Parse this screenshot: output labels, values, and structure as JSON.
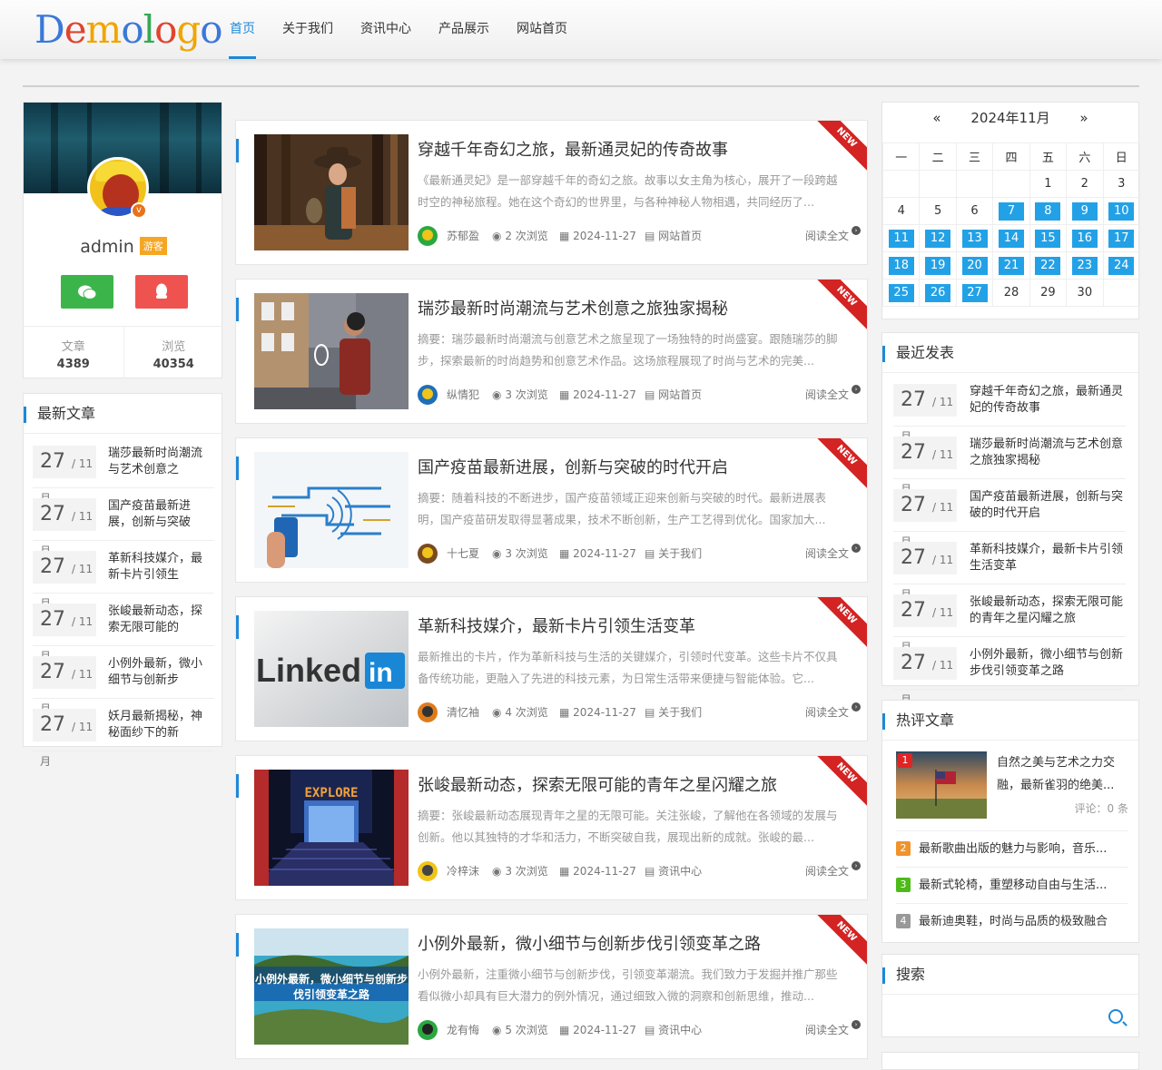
{
  "logo": {
    "letters": [
      "D",
      "e",
      "m",
      "o",
      "l",
      "o",
      "g",
      "o"
    ],
    "colors": [
      "#3b78d8",
      "#e0442f",
      "#f0a500",
      "#3b78d8",
      "#34a853",
      "#e0442f",
      "#f0a500",
      "#3b78d8"
    ]
  },
  "nav": [
    "首页",
    "关于我们",
    "资讯中心",
    "产品展示",
    "网站首页"
  ],
  "profile": {
    "name": "admin",
    "role": "游客",
    "posts_label": "文章",
    "posts": "4389",
    "views_label": "浏览",
    "views": "40354"
  },
  "latest": {
    "title": "最新文章",
    "items": [
      {
        "day": "27",
        "month": "/ 11月",
        "title": "瑞莎最新时尚潮流与艺术创意之"
      },
      {
        "day": "27",
        "month": "/ 11月",
        "title": "国产疫苗最新进展，创新与突破"
      },
      {
        "day": "27",
        "month": "/ 11月",
        "title": "革新科技媒介，最新卡片引领生"
      },
      {
        "day": "27",
        "month": "/ 11月",
        "title": "张峻最新动态，探索无限可能的"
      },
      {
        "day": "27",
        "month": "/ 11月",
        "title": "小例外最新，微小细节与创新步"
      },
      {
        "day": "27",
        "month": "/ 11月",
        "title": "妖月最新揭秘，神秘面纱下的新"
      }
    ]
  },
  "articles": [
    {
      "title": "穿越千年奇幻之旅，最新通灵妃的传奇故事",
      "excerpt": "《最新通灵妃》是一部穿越千年的奇幻之旅。故事以女主角为核心，展开了一段跨越时空的神秘旅程。她在这个奇幻的世界里，与各种神秘人物相遇，共同经历了...",
      "author": "苏郁盈",
      "views": "2 次浏览",
      "date": "2024-11-27",
      "cat": "网站首页",
      "read": "阅读全文",
      "ribbon": "NEW"
    },
    {
      "title": "瑞莎最新时尚潮流与艺术创意之旅独家揭秘",
      "excerpt": "摘要：瑞莎最新时尚潮流与创意艺术之旅呈现了一场独特的时尚盛宴。跟随瑞莎的脚步，探索最新的时尚趋势和创意艺术作品。这场旅程展现了时尚与艺术的完美...",
      "author": "纵情犯",
      "views": "3 次浏览",
      "date": "2024-11-27",
      "cat": "网站首页",
      "read": "阅读全文",
      "ribbon": "NEW"
    },
    {
      "title": "国产疫苗最新进展，创新与突破的时代开启",
      "excerpt": "摘要：随着科技的不断进步，国产疫苗领域正迎来创新与突破的时代。最新进展表明，国产疫苗研发取得显著成果，技术不断创新，生产工艺得到优化。国家加大...",
      "author": "十七夏",
      "views": "3 次浏览",
      "date": "2024-11-27",
      "cat": "关于我们",
      "read": "阅读全文",
      "ribbon": "NEW"
    },
    {
      "title": "革新科技媒介，最新卡片引领生活变革",
      "excerpt": "最新推出的卡片，作为革新科技与生活的关键媒介，引领时代变革。这些卡片不仅具备传统功能，更融入了先进的科技元素，为日常生活带来便捷与智能体验。它...",
      "author": "清忆袖",
      "views": "4 次浏览",
      "date": "2024-11-27",
      "cat": "关于我们",
      "read": "阅读全文",
      "ribbon": "NEW",
      "thumb_text": "Linked",
      "thumb_badge": "in"
    },
    {
      "title": "张峻最新动态，探索无限可能的青年之星闪耀之旅",
      "excerpt": "摘要：张峻最新动态展现青年之星的无限可能。关注张峻，了解他在各领域的发展与创新。他以其独特的才华和活力，不断突破自我，展现出新的成就。张峻的最...",
      "author": "冷梓沫",
      "views": "3 次浏览",
      "date": "2024-11-27",
      "cat": "资讯中心",
      "read": "阅读全文",
      "ribbon": "NEW",
      "thumb_text": "EXPLORE"
    },
    {
      "title": "小例外最新，微小细节与创新步伐引领变革之路",
      "excerpt": "小例外最新，注重微小细节与创新步伐，引领变革潮流。我们致力于发掘并推广那些看似微小却具有巨大潜力的例外情况，通过细致入微的洞察和创新思维，推动...",
      "author": "龙有悔",
      "views": "5 次浏览",
      "date": "2024-11-27",
      "cat": "资讯中心",
      "read": "阅读全文",
      "ribbon": "NEW",
      "thumb_text": "小例外最新，微小细节与创新步伐引领变革之路"
    }
  ],
  "calendar": {
    "prev": "«",
    "month": "2024年11月",
    "next": "»",
    "weekdays": [
      "一",
      "二",
      "三",
      "四",
      "五",
      "六",
      "日"
    ],
    "weeks": [
      [
        "",
        "",
        "",
        "",
        "1",
        "2",
        "3"
      ],
      [
        "4",
        "5",
        "6",
        "7",
        "8",
        "9",
        "10"
      ],
      [
        "11",
        "12",
        "13",
        "14",
        "15",
        "16",
        "17"
      ],
      [
        "18",
        "19",
        "20",
        "21",
        "22",
        "23",
        "24"
      ],
      [
        "25",
        "26",
        "27",
        "28",
        "29",
        "30",
        ""
      ]
    ],
    "linked_days": [
      "7",
      "8",
      "9",
      "10",
      "11",
      "12",
      "13",
      "14",
      "15",
      "16",
      "17",
      "18",
      "19",
      "20",
      "21",
      "22",
      "23",
      "24",
      "25",
      "26",
      "27"
    ]
  },
  "recent": {
    "title": "最近发表",
    "items": [
      {
        "day": "27",
        "month": "/ 11月",
        "title": "穿越千年奇幻之旅，最新通灵妃的传奇故事"
      },
      {
        "day": "27",
        "month": "/ 11月",
        "title": "瑞莎最新时尚潮流与艺术创意之旅独家揭秘"
      },
      {
        "day": "27",
        "month": "/ 11月",
        "title": "国产疫苗最新进展，创新与突破的时代开启"
      },
      {
        "day": "27",
        "month": "/ 11月",
        "title": "革新科技媒介，最新卡片引领生活变革"
      },
      {
        "day": "27",
        "month": "/ 11月",
        "title": "张峻最新动态，探索无限可能的青年之星闪耀之旅"
      },
      {
        "day": "27",
        "month": "/ 11月",
        "title": "小例外最新，微小细节与创新步伐引领变革之路"
      }
    ]
  },
  "hot": {
    "title": "热评文章",
    "top": {
      "rank": "1",
      "title": "自然之美与艺术之力交融，最新雀羽的绝美...",
      "comments": "评论：0 条"
    },
    "items": [
      {
        "rank": "2",
        "color": "#f0932b",
        "title": "最新歌曲出版的魅力与影响，音乐..."
      },
      {
        "rank": "3",
        "color": "#4cbb17",
        "title": "最新式轮椅，重塑移动自由与生活..."
      },
      {
        "rank": "4",
        "color": "#999999",
        "title": "最新迪奥鞋，时尚与品质的极致融合"
      }
    ],
    "rank1_color": "#e02424"
  },
  "search": {
    "title": "搜索",
    "placeholder": ""
  }
}
